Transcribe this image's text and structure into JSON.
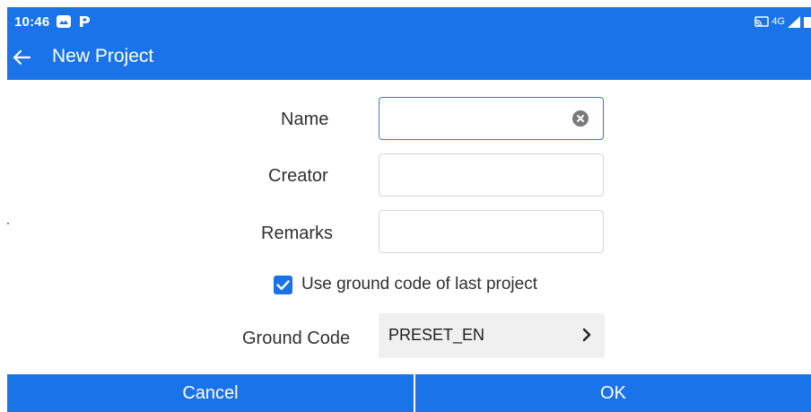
{
  "status_bar": {
    "time": "10:46",
    "network": "4G",
    "notification_icons": [
      "gallery-icon",
      "parking-icon"
    ],
    "right_icons": [
      "cast-icon",
      "signal-icon",
      "battery-icon"
    ]
  },
  "app_bar": {
    "title": "New Project",
    "back_icon": "back-arrow-icon"
  },
  "form": {
    "name_label": "Name",
    "name_value": "",
    "creator_label": "Creator",
    "creator_value": "",
    "remarks_label": "Remarks",
    "remarks_value": "",
    "use_last_ground_code_label": "Use ground code of last project",
    "use_last_ground_code_checked": true,
    "ground_code_label": "Ground Code",
    "ground_code_value": "PRESET_EN"
  },
  "buttons": {
    "cancel_label": "Cancel",
    "ok_label": "OK"
  },
  "colors": {
    "primary": "#1a73e8",
    "focus_border": "#3d77c2",
    "select_background": "#f0f0f0"
  }
}
